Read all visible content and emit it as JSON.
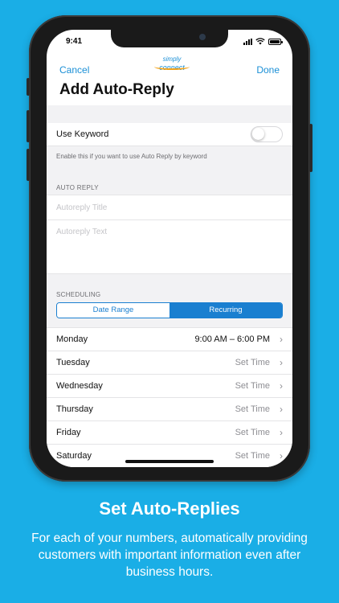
{
  "status_bar": {
    "time": "9:41"
  },
  "nav": {
    "cancel": "Cancel",
    "done": "Done",
    "logo_top": "simply",
    "logo_bottom": "connect"
  },
  "page_title": "Add Auto-Reply",
  "keyword": {
    "label": "Use Keyword",
    "hint": "Enable this if you want to use Auto Reply by keyword",
    "enabled": false
  },
  "auto_reply": {
    "header": "AUTO REPLY",
    "title_placeholder": "Autoreply Title",
    "text_placeholder": "Autoreply Text"
  },
  "scheduling": {
    "header": "SCHEDULING",
    "tabs": [
      {
        "label": "Date Range",
        "active": false
      },
      {
        "label": "Recurring",
        "active": true
      }
    ],
    "days": [
      {
        "day": "Monday",
        "time": "9:00 AM – 6:00 PM",
        "set": true
      },
      {
        "day": "Tuesday",
        "time": "Set Time",
        "set": false
      },
      {
        "day": "Wednesday",
        "time": "Set Time",
        "set": false
      },
      {
        "day": "Thursday",
        "time": "Set Time",
        "set": false
      },
      {
        "day": "Friday",
        "time": "Set Time",
        "set": false
      },
      {
        "day": "Saturday",
        "time": "Set Time",
        "set": false
      }
    ]
  },
  "marketing": {
    "headline": "Set Auto-Replies",
    "body": "For each of your numbers, automatically providing customers with important information even after business hours."
  },
  "colors": {
    "background": "#1aaee6",
    "accent": "#1a7fd0",
    "logo_swoosh": "#f2a31b"
  }
}
